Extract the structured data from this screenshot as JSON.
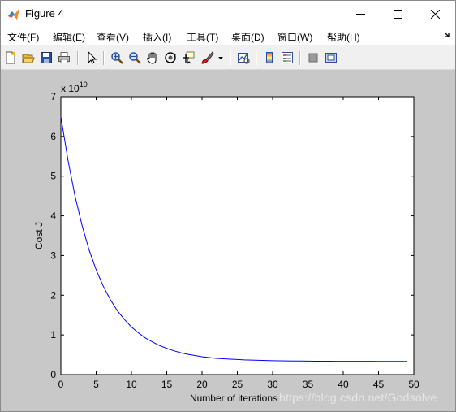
{
  "window": {
    "title": "Figure 4",
    "controls": [
      "minimize",
      "maximize",
      "close"
    ]
  },
  "menubar": {
    "items": [
      "文件(F)",
      "编辑(E)",
      "查看(V)",
      "插入(I)",
      "工具(T)",
      "桌面(D)",
      "窗口(W)",
      "帮助(H)"
    ]
  },
  "toolbar": {
    "icons": [
      "new-figure-icon",
      "open-file-icon",
      "save-icon",
      "print-icon",
      "edit-plot-arrow-icon",
      "zoom-in-icon",
      "zoom-out-icon",
      "pan-hand-icon",
      "rotate-3d-icon",
      "data-cursor-icon",
      "brush-icon",
      "brush-dropdown-icon",
      "link-plot-icon",
      "colorbar-icon",
      "legend-icon",
      "hide-plot-tools-icon",
      "show-plot-tools-icon"
    ]
  },
  "watermark": "https://blog.csdn.net/Godsolve",
  "chart_data": {
    "type": "line",
    "title": "",
    "xlabel": "Number of iterations",
    "ylabel": "Cost J",
    "y_multiplier": "x 10",
    "y_multiplier_exponent": "10",
    "xlim": [
      0,
      50
    ],
    "ylim": [
      0,
      7
    ],
    "xticks": [
      0,
      5,
      10,
      15,
      20,
      25,
      30,
      35,
      40,
      45,
      50
    ],
    "yticks": [
      0,
      1,
      2,
      3,
      4,
      5,
      6,
      7
    ],
    "grid": false,
    "series": [
      {
        "color": "#0000ff",
        "x": [
          0,
          1,
          2,
          3,
          4,
          5,
          6,
          7,
          8,
          9,
          10,
          11,
          12,
          13,
          14,
          15,
          16,
          17,
          18,
          19,
          20,
          21,
          22,
          23,
          24,
          25,
          26,
          27,
          28,
          29,
          30,
          31,
          32,
          33,
          34,
          35,
          36,
          37,
          38,
          39,
          40,
          41,
          42,
          43,
          44,
          45,
          46,
          47,
          48,
          49
        ],
        "y": [
          6.5,
          5.41,
          4.5,
          3.76,
          3.14,
          2.64,
          2.23,
          1.89,
          1.61,
          1.39,
          1.2,
          1.05,
          0.92,
          0.82,
          0.73,
          0.66,
          0.6,
          0.55,
          0.51,
          0.48,
          0.45,
          0.43,
          0.41,
          0.4,
          0.39,
          0.38,
          0.37,
          0.365,
          0.36,
          0.355,
          0.35,
          0.348,
          0.346,
          0.344,
          0.342,
          0.34,
          0.339,
          0.338,
          0.337,
          0.336,
          0.335,
          0.335,
          0.334,
          0.334,
          0.334,
          0.333,
          0.333,
          0.333,
          0.333,
          0.333
        ]
      }
    ]
  }
}
